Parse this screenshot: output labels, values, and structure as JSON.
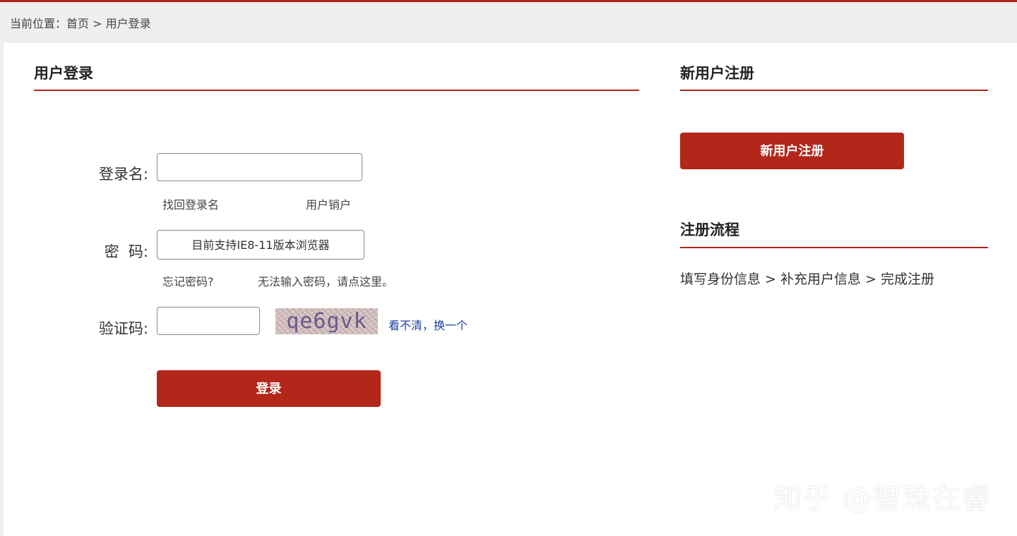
{
  "breadcrumb": {
    "text": "当前位置：首页 > 用户登录"
  },
  "login": {
    "title": "用户登录",
    "username_label": "登录名:",
    "username_value": "",
    "find_username": "找回登录名",
    "cancel_account": "用户销户",
    "password_label": "密  码:",
    "password_placeholder": "目前支持IE8-11版本浏览器",
    "forgot_password": "忘记密码?",
    "cannot_input_password": "无法输入密码，请点这里。",
    "captcha_label": "验证码:",
    "captcha_value": "",
    "captcha_text": "qe6gvk",
    "refresh_captcha": "看不清，换一个",
    "submit_label": "登录"
  },
  "register": {
    "title": "新用户注册",
    "button_label": "新用户注册",
    "flow_title": "注册流程",
    "flow_steps": "填写身份信息 > 补充用户信息 > 完成注册"
  },
  "watermark": {
    "text": "知乎 @智珠在睿"
  },
  "colors": {
    "accent": "#b3261a",
    "link": "#1a3fa0",
    "background": "#efefef",
    "panel": "#ffffff"
  }
}
